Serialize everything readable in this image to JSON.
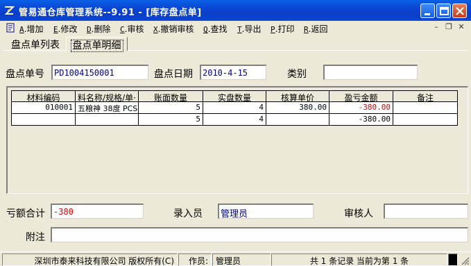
{
  "window": {
    "title": "管易通仓库管理系统--9.91 - [库存盘点单]"
  },
  "menu": {
    "items": [
      {
        "key": "A",
        "label": "增加"
      },
      {
        "key": "E",
        "label": "修改"
      },
      {
        "key": "D",
        "label": "删除"
      },
      {
        "key": "C",
        "label": "审核"
      },
      {
        "key": "X",
        "label": "撤销审核"
      },
      {
        "key": "Q",
        "label": "查找"
      },
      {
        "key": "T",
        "label": "导出"
      },
      {
        "key": "P",
        "label": "打印"
      },
      {
        "key": "R",
        "label": "返回"
      }
    ]
  },
  "tabs": [
    {
      "label": "盘点单列表",
      "active": false
    },
    {
      "label": "盘点单明细",
      "active": true
    }
  ],
  "form": {
    "order_no_label": "盘点单号",
    "order_no_value": "PD1004150001",
    "date_label": "盘点日期",
    "date_value": "2010-4-15",
    "category_label": "类别",
    "category_value": "",
    "loss_total_label": "亏额合计",
    "loss_total_value": "-380",
    "entry_label": "录入员",
    "entry_value": "管理员",
    "reviewer_label": "审核人",
    "reviewer_value": "",
    "note_label": "附注",
    "note_value": ""
  },
  "table": {
    "headers": [
      "材料编码",
      "料名称/规格/单·",
      "账面数量",
      "实盘数量",
      "核算单价",
      "盈亏金额",
      "备注"
    ],
    "rows": [
      [
        "010001",
        "五粮神 38度 PCS",
        "5",
        "4",
        "380.00",
        "-380.00",
        ""
      ],
      [
        "",
        "",
        "5",
        "4",
        "",
        "-380.00",
        ""
      ]
    ]
  },
  "status": {
    "company": "深圳市泰来科技有限公司 版权所有(C)",
    "operator_label": "作员:",
    "operator_value": "管理员",
    "record_info": "共 1 条记录 当前为第 1 条"
  },
  "colors": {
    "titlebar": "#0a46d4",
    "window_bg": "#ece9d8",
    "value_text": "#000080",
    "negative_text": "#e00000"
  }
}
